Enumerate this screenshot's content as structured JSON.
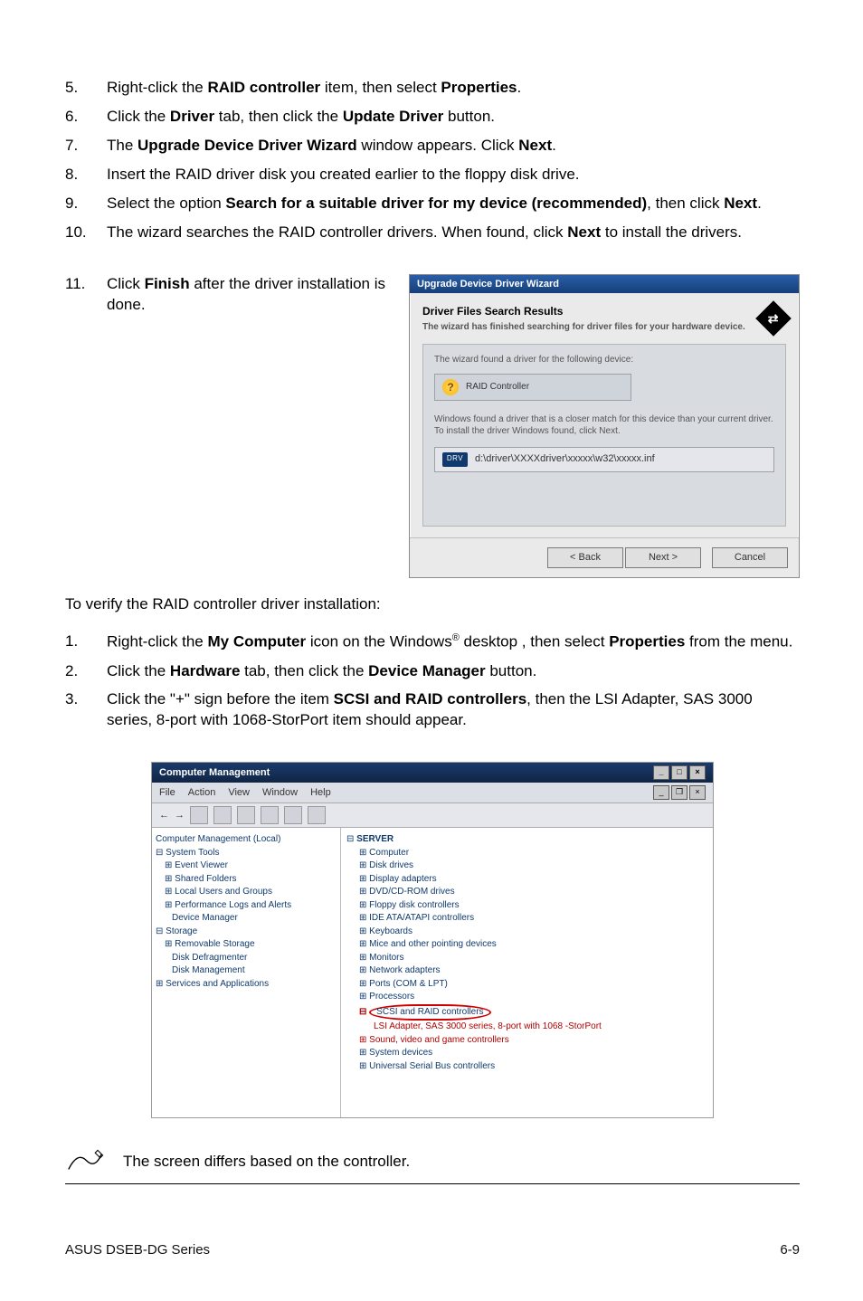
{
  "steps": [
    {
      "n": "5.",
      "pre": "Right-click the ",
      "b1": "RAID controller",
      "mid": " item, then select ",
      "b2": "Properties",
      "post": "."
    },
    {
      "n": "6.",
      "pre": "Click the ",
      "b1": "Driver",
      "mid": " tab, then click the ",
      "b2": "Update Driver",
      "post": " button."
    },
    {
      "n": "7.",
      "pre": "The ",
      "b1": "Upgrade Device Driver Wizard",
      "mid": " window appears. Click ",
      "b2": "Next",
      "post": "."
    },
    {
      "n": "8.",
      "plain": "Insert the RAID driver disk you created earlier to the floppy disk drive."
    },
    {
      "n": "9.",
      "pre": "Select the option ",
      "b1": "Search for a suitable driver for my device (recommended)",
      "mid": ", then click ",
      "b2": "Next",
      "post": "."
    },
    {
      "n": "10.",
      "pre": "The wizard searches the RAID controller drivers. When found, click ",
      "b1": "Next",
      "mid": " to install the drivers.",
      "b2": "",
      "post": ""
    },
    {
      "n": "11.",
      "pre": "Click ",
      "b1": "Finish",
      "mid": " after the driver installation is done.",
      "b2": "",
      "post": ""
    }
  ],
  "wizard": {
    "title": "Upgrade Device Driver Wizard",
    "heading": "Driver Files Search Results",
    "sub": "The wizard has finished searching for driver files for your hardware device.",
    "insetTop": "The wizard found a driver for the following device:",
    "chip": "RAID Controller",
    "found": "Windows found a driver that is a closer match for this device than your current driver. To install the driver Windows found, click Next.",
    "driverPath": "d:\\driver\\XXXXdriver\\xxxxx\\w32\\xxxxx.inf",
    "btnBack": "< Back",
    "btnNext": "Next >",
    "btnCancel": "Cancel"
  },
  "verifyHeader": "To verify the RAID controller driver installation:",
  "verifySteps": [
    {
      "n": "1.",
      "pre": "Right-click the ",
      "b1": "My Computer",
      "mid": " icon on the Windows",
      "sup": "®",
      "mid2": " desktop , then select ",
      "b2": "Properties",
      "post": " from the menu."
    },
    {
      "n": "2.",
      "pre": "Click the ",
      "b1": "Hardware",
      "mid": " tab, then click the ",
      "b2": "Device Manager",
      "post": " button."
    },
    {
      "n": "3.",
      "pre": "Click the \"+\" sign before the item ",
      "b1": "SCSI and RAID controllers",
      "mid": ", then the LSI Adapter, SAS 3000 series, 8-port with 1068-StorPort item should appear.",
      "b2": "",
      "post": ""
    }
  ],
  "mgr": {
    "title": "Computer Management",
    "menu": [
      "File",
      "Action",
      "View",
      "Window",
      "Help"
    ],
    "leftTree": [
      "Computer Management (Local)",
      "⊟ System Tools",
      "  ⊞ Event Viewer",
      "  ⊞ Shared Folders",
      "  ⊞ Local Users and Groups",
      "  ⊞ Performance Logs and Alerts",
      "    Device Manager",
      "⊟ Storage",
      "  ⊞ Removable Storage",
      "    Disk Defragmenter",
      "    Disk Management",
      "⊞ Services and Applications"
    ],
    "rightServer": "SERVER",
    "rightTree": [
      "⊞ Computer",
      "⊞ Disk drives",
      "⊞ Display adapters",
      "⊞ DVD/CD-ROM drives",
      "⊞ Floppy disk controllers",
      "⊞ IDE ATA/ATAPI controllers",
      "⊞ Keyboards",
      "⊞ Mice and other pointing devices",
      "⊞ Monitors",
      "⊞ Network adapters",
      "⊞ Ports (COM & LPT)",
      "⊞ Processors"
    ],
    "scsiNode": "SCSI and RAID controllers",
    "scsiChild": "LSI Adapter, SAS 3000 series, 8-port with 1068 -StorPort",
    "afterTree": [
      "⊞ Sound, video and game controllers",
      "⊞ System devices",
      "⊞ Universal Serial Bus controllers"
    ]
  },
  "note": "The screen differs based on the controller.",
  "footerLeft": "ASUS DSEB-DG Series",
  "footerRight": "6-9"
}
